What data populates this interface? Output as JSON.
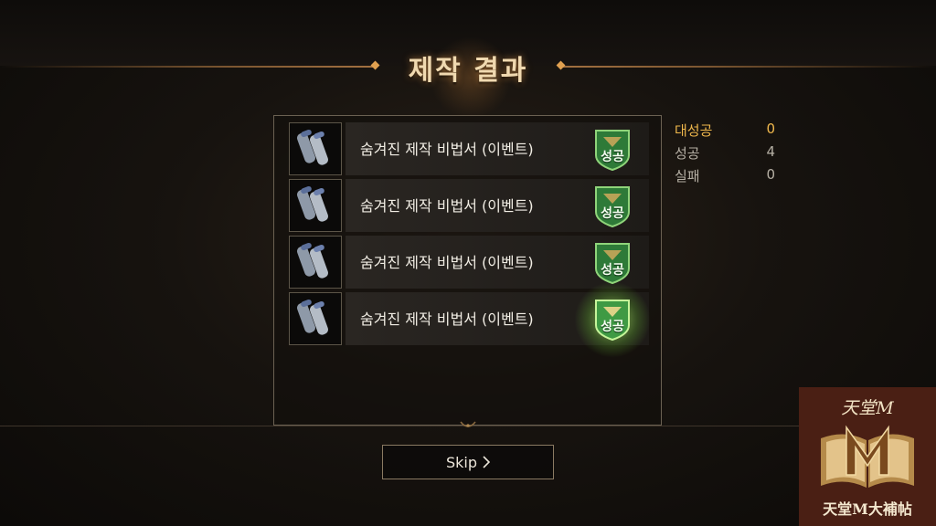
{
  "header": {
    "title": "제작 결과"
  },
  "results": [
    {
      "item_name": "숨겨진 제작 비법서 (이벤트)",
      "result": "성공",
      "icon": "scroll-icon"
    },
    {
      "item_name": "숨겨진 제작 비법서 (이벤트)",
      "result": "성공",
      "icon": "scroll-icon"
    },
    {
      "item_name": "숨겨진 제작 비법서 (이벤트)",
      "result": "성공",
      "icon": "scroll-icon"
    },
    {
      "item_name": "숨겨진 제작 비법서 (이벤트)",
      "result": "성공",
      "icon": "scroll-icon",
      "highlighted": true
    }
  ],
  "stats": [
    {
      "label": "대성공",
      "value": "0"
    },
    {
      "label": "성공",
      "value": "4"
    },
    {
      "label": "실패",
      "value": "0"
    }
  ],
  "skip_button": {
    "label": "Skip",
    "icon": "chevron-right-icon"
  },
  "watermark": {
    "top_text": "天堂M",
    "bottom_text": "天堂M大補帖",
    "logo": "book-m-logo"
  },
  "colors": {
    "title": "#f0d9b0",
    "accent": "#f0b84c",
    "success_badge": "#2e7a38",
    "panel_border": "#6b6152"
  }
}
